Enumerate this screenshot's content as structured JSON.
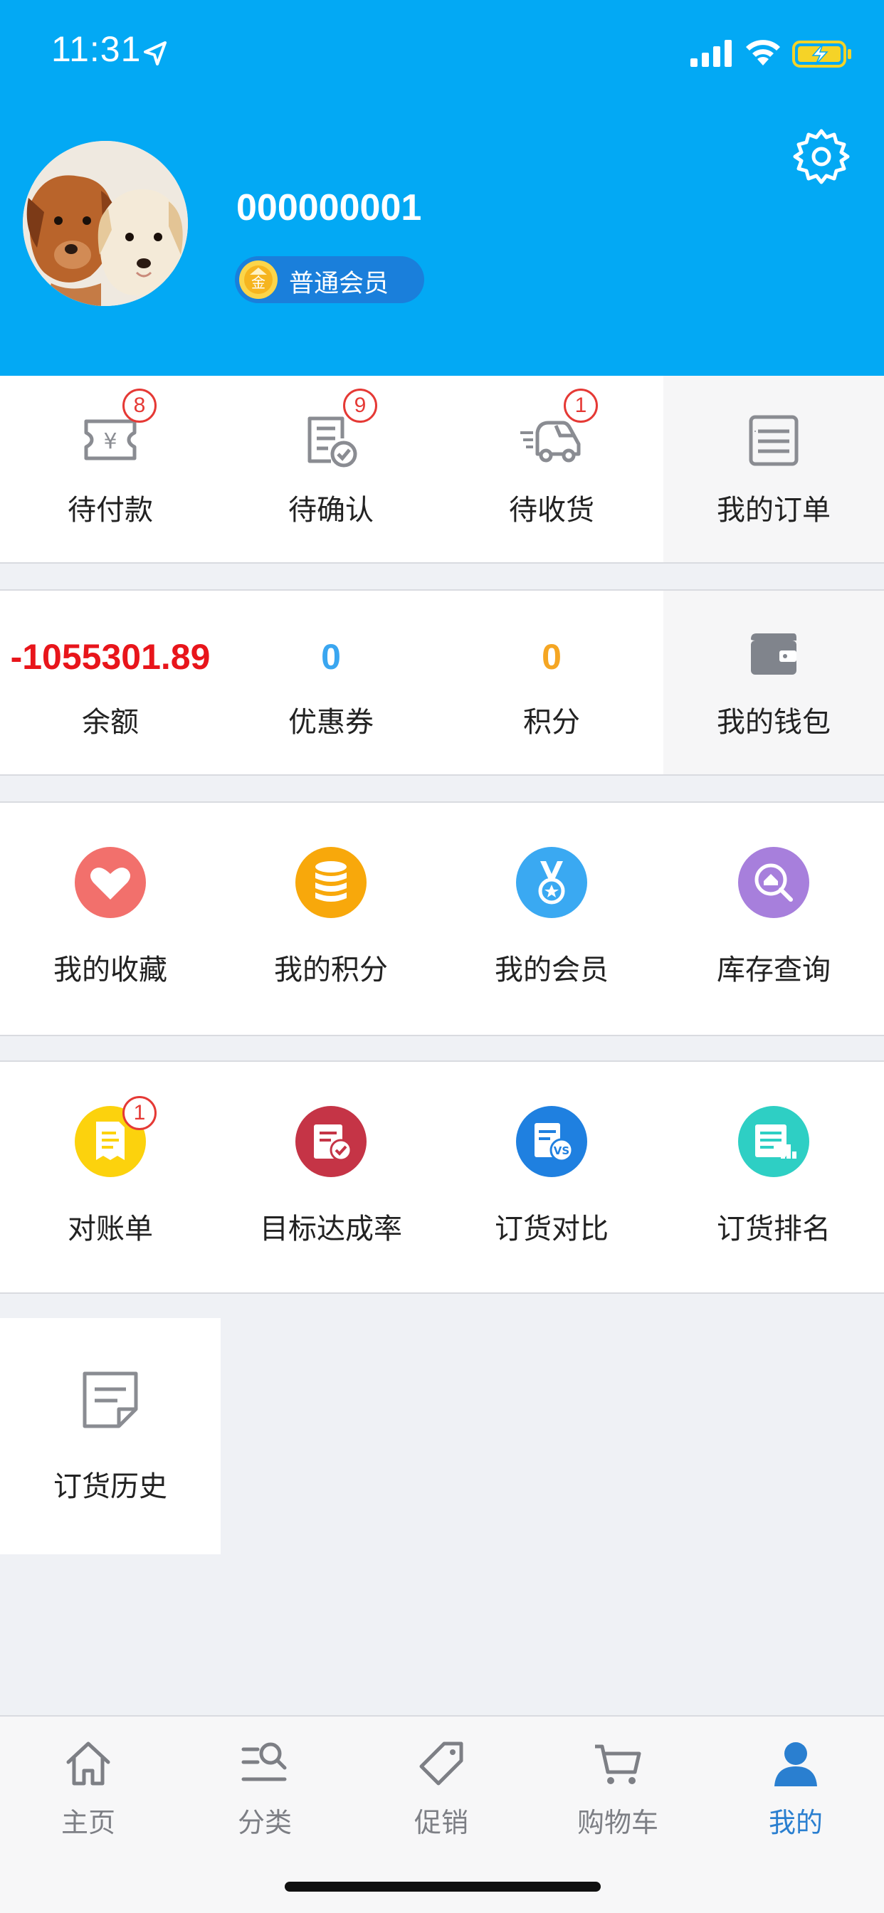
{
  "status_bar": {
    "time": "11:31"
  },
  "profile": {
    "username": "000000001",
    "member_level": "普通会员",
    "coin_glyph": "金",
    "avatar": "puppies-photo"
  },
  "orders": [
    {
      "label": "待付款",
      "badge": "8",
      "icon": "ticket-icon"
    },
    {
      "label": "待确认",
      "badge": "9",
      "icon": "checklist-icon"
    },
    {
      "label": "待收货",
      "badge": "1",
      "icon": "truck-icon"
    },
    {
      "label": "我的订单",
      "badge": null,
      "icon": "order-list-icon"
    }
  ],
  "wallet": [
    {
      "value": "-1055301.89",
      "label": "余额",
      "color": "#e8151b"
    },
    {
      "value": "0",
      "label": "优惠券",
      "color": "#3aa6f0"
    },
    {
      "value": "0",
      "label": "积分",
      "color": "#f5a623"
    },
    {
      "label": "我的钱包",
      "icon": "wallet-icon"
    }
  ],
  "features_row1": [
    {
      "label": "我的收藏",
      "icon": "heart-icon",
      "color": "#f2706c"
    },
    {
      "label": "我的积分",
      "icon": "coins-stack-icon",
      "color": "#f8a80b"
    },
    {
      "label": "我的会员",
      "icon": "medal-icon",
      "color": "#3aa9f2"
    },
    {
      "label": "库存查询",
      "icon": "inventory-search-icon",
      "color": "#a77fdc"
    }
  ],
  "features_row2": [
    {
      "label": "对账单",
      "icon": "statement-icon",
      "color": "#fcd20d",
      "badge": "1"
    },
    {
      "label": "目标达成率",
      "icon": "target-check-icon",
      "color": "#c53446"
    },
    {
      "label": "订货对比",
      "icon": "vs-compare-icon",
      "color": "#1f80e0"
    },
    {
      "label": "订货排名",
      "icon": "ranking-icon",
      "color": "#2ecfc4"
    }
  ],
  "features_row3": [
    {
      "label": "订货历史",
      "icon": "history-note-icon"
    }
  ],
  "tabbar": [
    {
      "label": "主页",
      "icon": "home-icon"
    },
    {
      "label": "分类",
      "icon": "category-search-icon"
    },
    {
      "label": "促销",
      "icon": "tag-icon"
    },
    {
      "label": "购物车",
      "icon": "cart-icon"
    },
    {
      "label": "我的",
      "icon": "user-icon",
      "active": true
    }
  ],
  "colors": {
    "header_bg": "#03a9f4",
    "page_bg": "#eff1f5",
    "badge_red": "#e53935",
    "active_tab": "#2a7fd0"
  }
}
